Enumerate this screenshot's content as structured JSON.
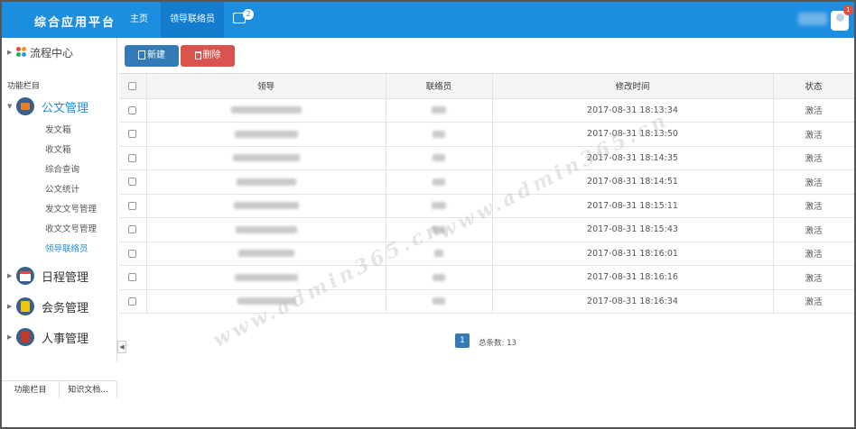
{
  "header": {
    "brand": "综合应用平台",
    "nav": [
      {
        "label": "主页"
      },
      {
        "label": "领导联络员"
      }
    ],
    "message_count": "2",
    "notification_count": "1"
  },
  "sidebar": {
    "flow_center": "流程中心",
    "section_title": "功能栏目",
    "doc_group": "公文管理",
    "doc_items": [
      "发文箱",
      "收文箱",
      "综合查询",
      "公文统计",
      "发文文号管理",
      "收文文号管理",
      "领导联络员"
    ],
    "schedule_group": "日程管理",
    "meeting_group": "会务管理",
    "hr_group": "人事管理",
    "bottom_tabs": [
      "功能栏目",
      "知识文档..."
    ]
  },
  "toolbar": {
    "new_label": "新建",
    "delete_label": "删除"
  },
  "table": {
    "columns": [
      "领导",
      "联络员",
      "修改时间",
      "状态"
    ],
    "rows": [
      {
        "time": "2017-08-31 18:13:34",
        "status": "激活"
      },
      {
        "time": "2017-08-31 18:13:50",
        "status": "激活"
      },
      {
        "time": "2017-08-31 18:14:35",
        "status": "激活"
      },
      {
        "time": "2017-08-31 18:14:51",
        "status": "激活"
      },
      {
        "time": "2017-08-31 18:15:11",
        "status": "激活"
      },
      {
        "time": "2017-08-31 18:15:43",
        "status": "激活"
      },
      {
        "time": "2017-08-31 18:16:01",
        "status": "激活"
      },
      {
        "time": "2017-08-31 18:16:16",
        "status": "激活"
      },
      {
        "time": "2017-08-31 18:16:34",
        "status": "激活"
      }
    ]
  },
  "pagination": {
    "current_page": "1",
    "total_label": "总条数: 13"
  },
  "watermark": "www.admin365.cn",
  "colors": {
    "topbar": "#1c8ee0",
    "primary": "#337ab7",
    "danger": "#d9534f",
    "badge": "#e74c3c"
  }
}
